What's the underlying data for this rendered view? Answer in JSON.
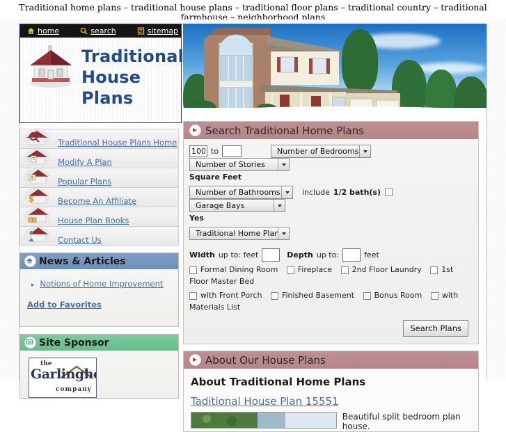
{
  "banner": {
    "text": "Traditional home plans – traditional house plans – traditional floor plans – traditional country – traditional farmhouse – neighborhood plans"
  },
  "topnav": {
    "items": [
      {
        "label": "home",
        "icon": "home-icon"
      },
      {
        "label": "search",
        "icon": "magnifier-icon"
      },
      {
        "label": "sitemap",
        "icon": "sitemap-icon"
      }
    ]
  },
  "logo": {
    "line1": "Traditional",
    "line2": "House",
    "line3": "Plans",
    "icon": "house-logo-icon",
    "color": "#234a86"
  },
  "sidebar": {
    "links": [
      {
        "label": "Traditional House Plans Home",
        "icon": "house-search-icon"
      },
      {
        "label": "Modify A Plan",
        "icon": "house-pencil-icon"
      },
      {
        "label": "Popular Plans",
        "icon": "house-star-icon"
      },
      {
        "label": "Become An Affiliate",
        "icon": "house-dollar-icon"
      },
      {
        "label": "House Plan Books",
        "icon": "house-book-icon"
      },
      {
        "label": "Contact Us",
        "icon": "house-person-icon"
      }
    ],
    "news": {
      "title": "News & Articles",
      "icon": "house-circle-icon",
      "header_color": "#7490b8",
      "article": "Notions of Home Improvement",
      "favorites": "Add to Favorites"
    },
    "sponsor": {
      "title": "Site Sponsor",
      "icon": "sponsor-circle-icon",
      "header_color": "#6cc295",
      "logo": {
        "the": "the",
        "name": "Garlinghouse",
        "company": "company"
      }
    }
  },
  "search_panel": {
    "title": "Search Traditional Home Plans",
    "icon": "arrow-circle-icon",
    "header_color": "#b4858a",
    "sqft_min": "100",
    "sqft_max": "",
    "to_label": "to",
    "sqft_label": "Square Feet",
    "bedrooms_select": "Number of Bedrooms",
    "stories_select": "Number of Stories",
    "bathrooms_select": "Number of Bathrooms",
    "include_label": "include",
    "half_bath_label": "1/2 bath(s)",
    "yes_label": "Yes",
    "garage_select": "Garage Bays",
    "plantype_select": "Traditional Home Plans",
    "width_label": "Width",
    "width_upto": "up to: feet",
    "width_value": "",
    "depth_label": "Depth",
    "depth_upto": "up to:",
    "depth_value": "",
    "feet_label": "feet",
    "checks_row1": [
      "Formal Dining Room",
      "Fireplace",
      "2nd Floor Laundry",
      "1st Floor Master Bed"
    ],
    "checks_row2": [
      "with Front Porch",
      "Finished Basement",
      "Bonus Room",
      "with Materials List"
    ],
    "submit_label": "Search Plans"
  },
  "about_panel": {
    "title": "About Our House Plans",
    "icon": "arrow-circle-icon",
    "heading": "About Traditional Home Plans",
    "plan_link": "Taditional House Plan 15551",
    "plan_desc": "Beautiful split bedroom plan house."
  }
}
